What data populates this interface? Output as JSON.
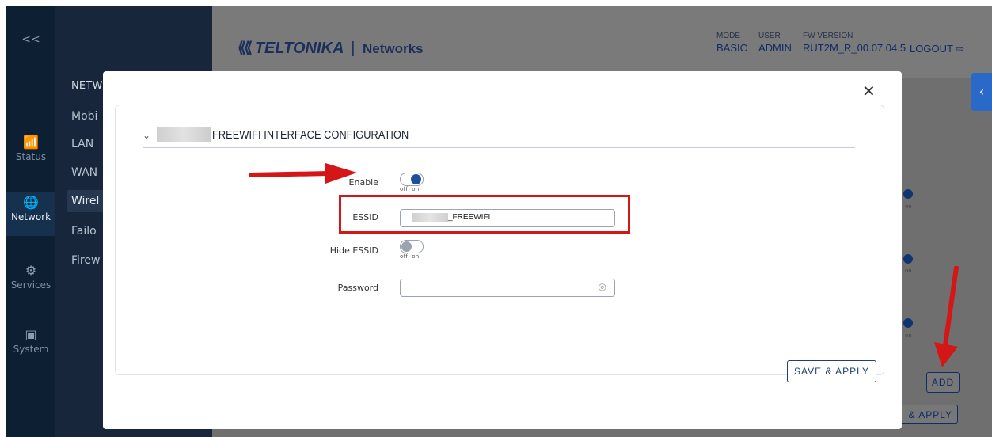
{
  "sidebar": {
    "collapse_label": "<<",
    "items": [
      {
        "label": "Status",
        "icon": "signal-bars-icon"
      },
      {
        "label": "Network",
        "icon": "globe-icon"
      },
      {
        "label": "Services",
        "icon": "gear-icon"
      },
      {
        "label": "System",
        "icon": "device-icon"
      }
    ]
  },
  "subnav": {
    "title": "NETWORK",
    "items": [
      "Mobi",
      "LAN",
      "WAN",
      "Wirel",
      "Failo",
      "Firew"
    ]
  },
  "header": {
    "logo_brand": "TELTONIKA",
    "logo_separator": "|",
    "logo_suffix": "Networks",
    "mode_label": "MODE",
    "mode_value": "BASIC",
    "user_label": "USER",
    "user_value": "ADMIN",
    "fw_label": "FW VERSION",
    "fw_value": "RUT2M_R_00.07.04.5",
    "logout_label": "LOGOUT"
  },
  "background": {
    "toggle_caption": "on",
    "add_label": "ADD",
    "apply_fragment": "& APPLY"
  },
  "modal": {
    "section_title": "FREEWIFI INTERFACE CONFIGURATION",
    "enable_label": "Enable",
    "enable_state": "on",
    "toggle_off": "off",
    "toggle_on": "on",
    "essid_label": "ESSID",
    "essid_value": "_FREEWIFI",
    "hide_essid_label": "Hide ESSID",
    "hide_essid_state": "off",
    "password_label": "Password",
    "password_value": "",
    "save_label": "SAVE & APPLY",
    "close_label": "✕"
  },
  "colors": {
    "accent": "#103670",
    "annotation_red": "#d51616",
    "sidebar_bg": "#0c1f33"
  }
}
